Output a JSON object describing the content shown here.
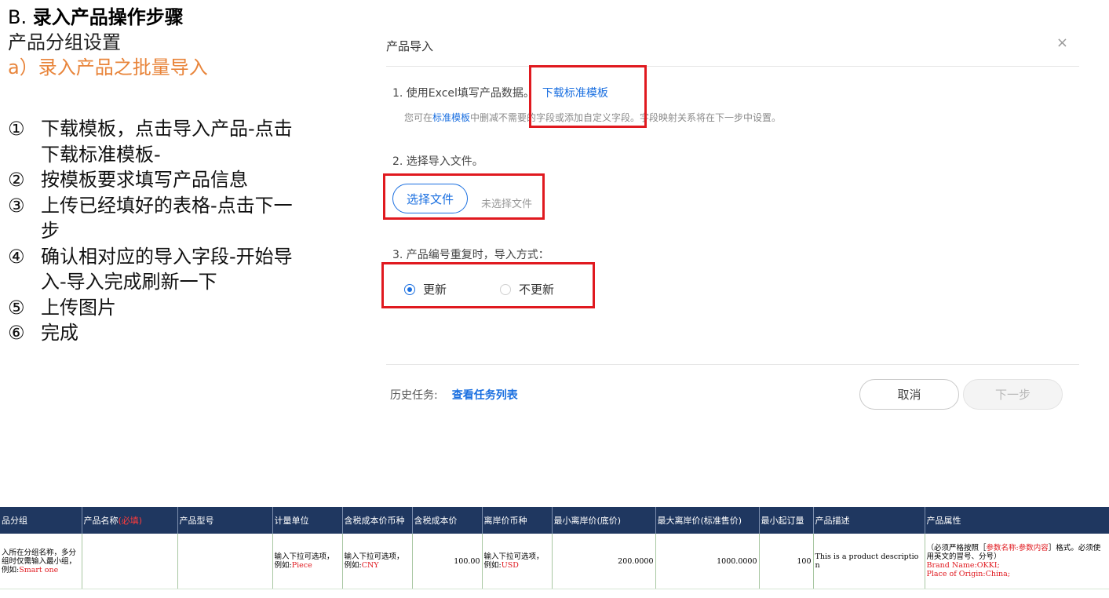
{
  "instructions": {
    "section_letter": "B.",
    "section_title": "录入产品操作步骤",
    "subheading": "产品分组设置",
    "subheading_orange": "a）录入产品之批量导入",
    "steps": [
      {
        "num": "①",
        "text": "下载模板，点击导入产品-点击下载标准模板-"
      },
      {
        "num": "②",
        "text": "按模板要求填写产品信息"
      },
      {
        "num": "③",
        "text": "上传已经填好的表格-点击下一步"
      },
      {
        "num": "④",
        "text": "确认相对应的导入字段-开始导入-导入完成刷新一下"
      },
      {
        "num": "⑤",
        "text": "上传图片"
      },
      {
        "num": "⑥",
        "text": "完成"
      }
    ]
  },
  "dialog": {
    "title": "产品导入",
    "close_glyph": "×",
    "step1_text": "1. 使用Excel填写产品数据。",
    "step1_link": "下载标准模板",
    "step1_sub_prefix": "您可在",
    "step1_sub_link": "标准模板",
    "step1_sub_suffix": "中删减不需要的字段或添加自定义字段。字段映射关系将在下一步中设置。",
    "step2_text": "2. 选择导入文件。",
    "file_button": "选择文件",
    "file_status": "未选择文件",
    "step3_text": "3. 产品编号重复时，导入方式：",
    "radio_update": "更新",
    "radio_no_update": "不更新",
    "selected_option": "更新",
    "history_label": "历史任务:",
    "history_link": "查看任务列表",
    "cancel_button": "取消",
    "next_button": "下一步",
    "accent_color": "#1a6fe0",
    "highlight_color": "#e0191f"
  },
  "sheet": {
    "header_color": "#1f3760",
    "headers": [
      {
        "label": "品分组",
        "req": ""
      },
      {
        "label": "产品名称",
        "req": "(必填)"
      },
      {
        "label": "产品型号",
        "req": ""
      },
      {
        "label": "计量单位",
        "req": ""
      },
      {
        "label": "含税成本价币种",
        "req": ""
      },
      {
        "label": "含税成本价",
        "req": ""
      },
      {
        "label": "离岸价币种",
        "req": ""
      },
      {
        "label": "最小离岸价(底价)",
        "req": ""
      },
      {
        "label": "最大离岸价(标准售价)",
        "req": ""
      },
      {
        "label": "最小起订量",
        "req": ""
      },
      {
        "label": "产品描述",
        "req": ""
      },
      {
        "label": "产品属性",
        "req": ""
      }
    ],
    "row": {
      "group_text": "入所在分组名称，多分组时仅需输入最小组，例如:",
      "group_example": "Smart one",
      "name": "",
      "model": "",
      "unit_text": "输入下拉可选项，例如:",
      "unit_example": "Piece",
      "cost_currency_text": "输入下拉可选项，例如:",
      "cost_currency_example": "CNY",
      "cost_price": "100.00",
      "fob_currency_text": "输入下拉可选项，例如:",
      "fob_currency_example": "USD",
      "min_fob": "200.0000",
      "max_fob": "1000.0000",
      "moq": "100",
      "description": "This is a product description",
      "attr_prefix": "（必须严格按照［",
      "attr_red": "参数名称:参数内容",
      "attr_suffix": "］格式。必须使用英文的冒号、分号）",
      "attr_line1": "Brand Name:OKKI;",
      "attr_line2": "Place of Origin:China;"
    }
  }
}
